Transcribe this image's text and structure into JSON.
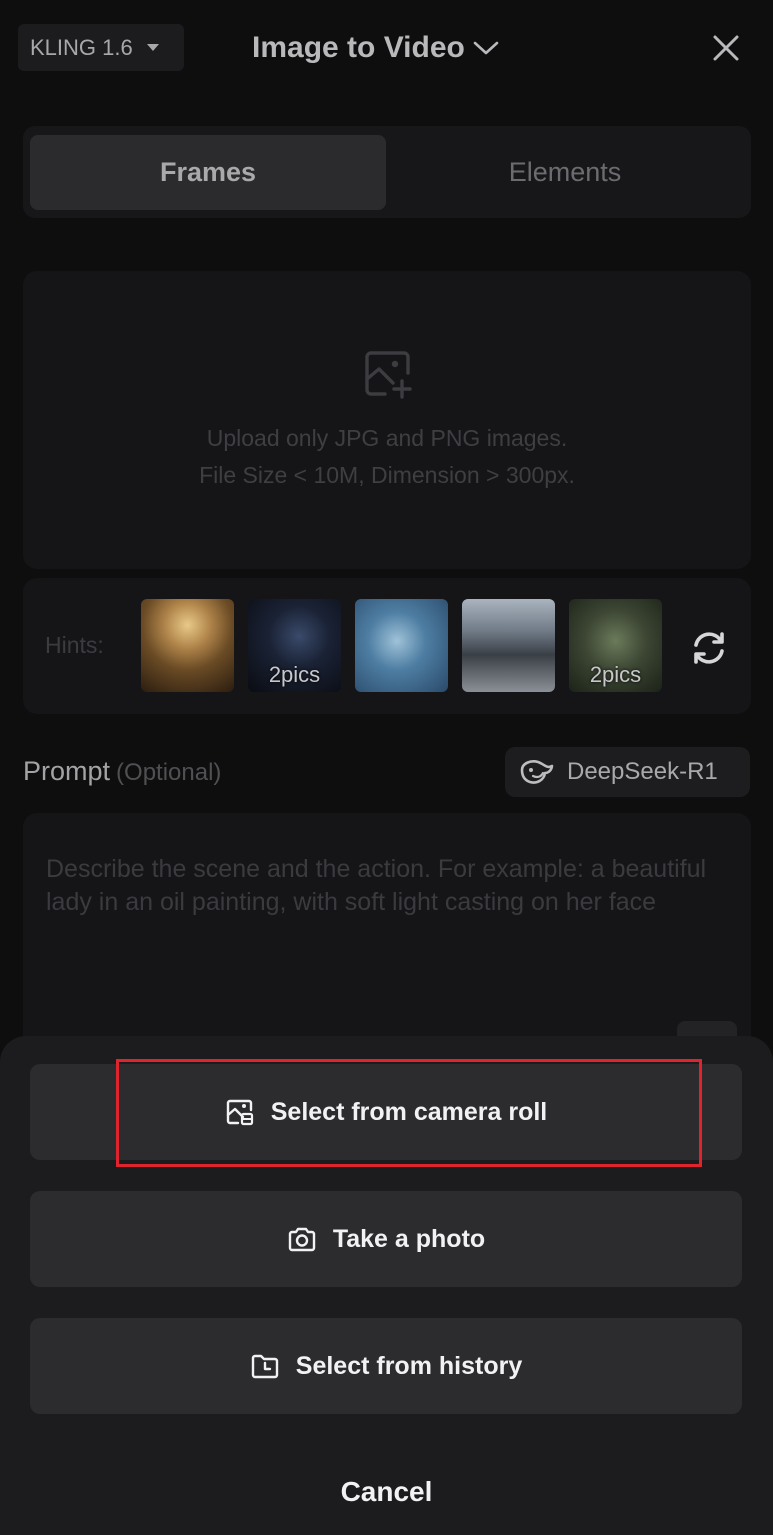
{
  "header": {
    "model_label": "KLING 1.6",
    "title": "Image to Video"
  },
  "tabs": [
    {
      "label": "Frames",
      "active": true
    },
    {
      "label": "Elements",
      "active": false
    }
  ],
  "upload": {
    "line1": "Upload only JPG and PNG images.",
    "line2": "File Size < 10M, Dimension > 300px."
  },
  "hints": {
    "label": "Hints:",
    "thumbnails": [
      {
        "badge": ""
      },
      {
        "badge": "2pics"
      },
      {
        "badge": ""
      },
      {
        "badge": ""
      },
      {
        "badge": "2pics"
      }
    ]
  },
  "prompt": {
    "label": "Prompt",
    "optional": "(Optional)",
    "assistant": "DeepSeek-R1",
    "placeholder": "Describe the scene and the action. For example: a beautiful lady in an oil painting, with soft light casting on her face"
  },
  "sheet": {
    "camera_roll": "Select from camera roll",
    "take_photo": "Take a photo",
    "history": "Select from history",
    "cancel": "Cancel"
  },
  "colors": {
    "highlight": "#e0242e",
    "background": "#0e0e0f",
    "sheet": "#1c1c1e",
    "sheet_button": "#2c2c2e"
  }
}
